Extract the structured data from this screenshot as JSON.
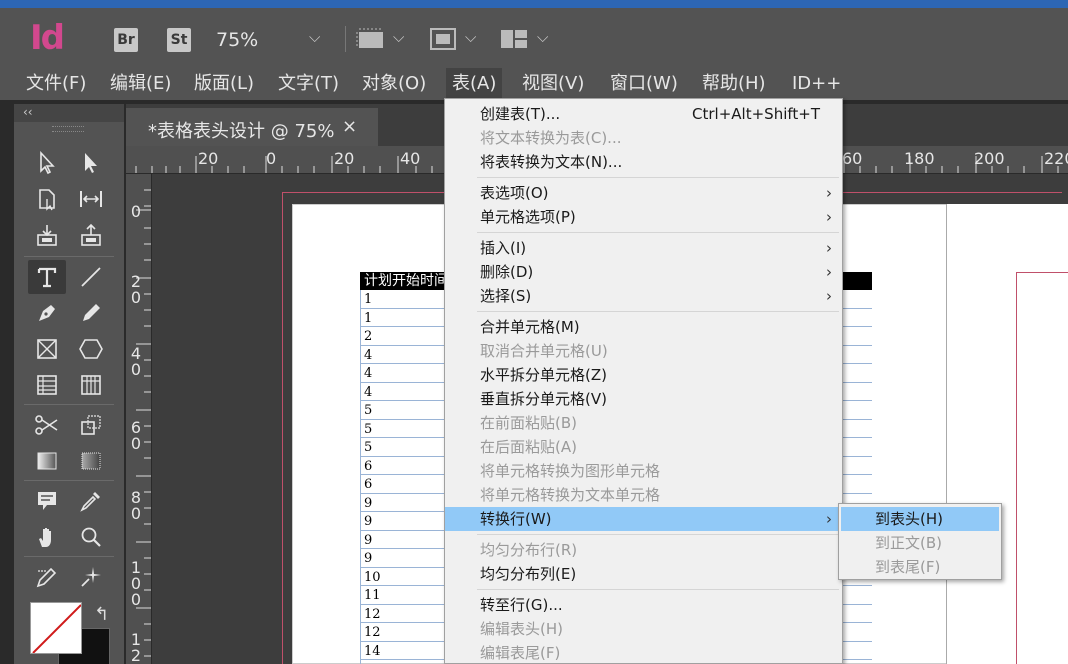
{
  "app": {
    "logo": "Id",
    "bridge_badge": "Br",
    "stock_badge": "St",
    "zoom": "75%",
    "icons": [
      "screen-mode-icon",
      "view-options-icon",
      "arrange-documents-icon",
      "chevron-down-icon"
    ]
  },
  "menubar": [
    {
      "label": "文件(F)",
      "active": false
    },
    {
      "label": "编辑(E)",
      "active": false
    },
    {
      "label": "版面(L)",
      "active": false
    },
    {
      "label": "文字(T)",
      "active": false
    },
    {
      "label": "对象(O)",
      "active": false
    },
    {
      "label": "表(A)",
      "active": true
    },
    {
      "label": "视图(V)",
      "active": false
    },
    {
      "label": "窗口(W)",
      "active": false
    },
    {
      "label": "帮助(H)",
      "active": false
    },
    {
      "label": "ID++",
      "active": false
    }
  ],
  "document": {
    "tab_title": "*表格表头设计 @ 75%",
    "close_glyph": "×",
    "ruler_h": [
      "20",
      "0",
      "20",
      "40",
      "60",
      "180",
      "200",
      "220"
    ],
    "ruler_v": [
      "0",
      "2\n0",
      "4\n0",
      "6\n0",
      "8\n0",
      "1\n0\n0",
      "1\n2"
    ]
  },
  "table": {
    "header": "计划开始时间",
    "rows": [
      "1",
      "1",
      "2",
      "4",
      "4",
      "4",
      "5",
      "5",
      "5",
      "6",
      "6",
      "9",
      "9",
      "9",
      "9",
      "10",
      "11",
      "12",
      "12",
      "14"
    ]
  },
  "table_menu": {
    "items": [
      {
        "label": "创建表(T)...",
        "shortcut": "Ctrl+Alt+Shift+T",
        "enabled": true
      },
      {
        "label": "将文本转换为表(C)...",
        "enabled": false
      },
      {
        "label": "将表转换为文本(N)...",
        "enabled": true
      },
      {
        "label": "表选项(O)",
        "submenu": true,
        "enabled": true
      },
      {
        "label": "单元格选项(P)",
        "submenu": true,
        "enabled": true
      },
      {
        "label": "插入(I)",
        "submenu": true,
        "enabled": true
      },
      {
        "label": "删除(D)",
        "submenu": true,
        "enabled": true
      },
      {
        "label": "选择(S)",
        "submenu": true,
        "enabled": true
      },
      {
        "label": "合并单元格(M)",
        "enabled": true
      },
      {
        "label": "取消合并单元格(U)",
        "enabled": false
      },
      {
        "label": "水平拆分单元格(Z)",
        "enabled": true
      },
      {
        "label": "垂直拆分单元格(V)",
        "enabled": true
      },
      {
        "label": "在前面粘贴(B)",
        "enabled": false
      },
      {
        "label": "在后面粘贴(A)",
        "enabled": false
      },
      {
        "label": "将单元格转换为图形单元格",
        "enabled": false
      },
      {
        "label": "将单元格转换为文本单元格",
        "enabled": false
      },
      {
        "label": "转换行(W)",
        "submenu": true,
        "enabled": true,
        "highlighted": true
      },
      {
        "label": "均匀分布行(R)",
        "enabled": false
      },
      {
        "label": "均匀分布列(E)",
        "enabled": true
      },
      {
        "label": "转至行(G)...",
        "enabled": true
      },
      {
        "label": "编辑表头(H)",
        "enabled": false
      },
      {
        "label": "编辑表尾(F)",
        "enabled": false
      }
    ],
    "submenu_arrow": "›"
  },
  "convert_row_submenu": {
    "items": [
      {
        "label": "到表头(H)",
        "enabled": true,
        "highlighted": true
      },
      {
        "label": "到正文(B)",
        "enabled": false
      },
      {
        "label": "到表尾(F)",
        "enabled": false
      }
    ]
  },
  "colors": {
    "highlight": "#91c9f7",
    "menu_bg": "#f0f0f0",
    "ui_dark": "#535353",
    "accent": "#d2488e",
    "title_strip": "#2d66b4"
  }
}
